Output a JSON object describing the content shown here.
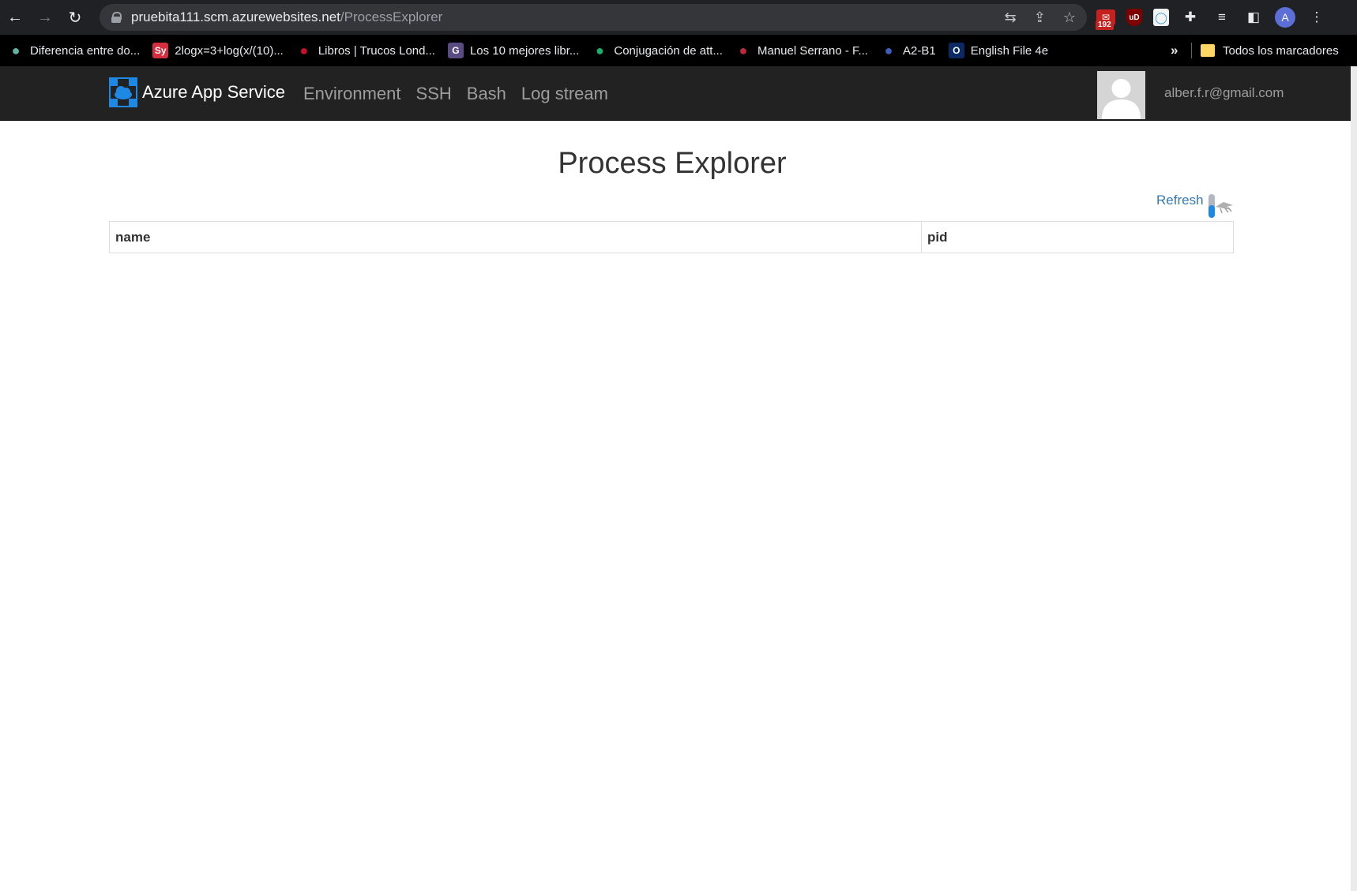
{
  "browser": {
    "url_host": "pruebita111.scm.azurewebsites.net",
    "url_path": "/ProcessExplorer",
    "mail_badge": "192",
    "ublock_label": "uD",
    "profile_initial": "A"
  },
  "bookmarks": {
    "items": [
      {
        "label": "Diferencia entre do...",
        "icon": "leaf-icon",
        "icon_text": "",
        "color": "#5fb3a1"
      },
      {
        "label": "2logx=3+log(x/(10)...",
        "icon": "symbolab-icon",
        "icon_text": "Sy",
        "color": "#d62d3f"
      },
      {
        "label": "Libros | Trucos Lond...",
        "icon": "union-jack-icon",
        "icon_text": "",
        "color": "#c8102e"
      },
      {
        "label": "Los 10 mejores libr...",
        "icon": "g-icon",
        "icon_text": "G",
        "color": "#5a4b82"
      },
      {
        "label": "Conjugación de att...",
        "icon": "green-bubble-icon",
        "icon_text": "",
        "color": "#17b26a"
      },
      {
        "label": "Manuel Serrano - F...",
        "icon": "signature-icon",
        "icon_text": "",
        "color": "#c0283b"
      },
      {
        "label": "A2-B1",
        "icon": "flag-icon",
        "icon_text": "",
        "color": "#3a5fbf"
      },
      {
        "label": "English File 4e",
        "icon": "oxford-icon",
        "icon_text": "O",
        "color": "#0a2a66"
      }
    ],
    "overflow": "»",
    "all_bookmarks": "Todos los marcadores"
  },
  "navbar": {
    "brand": "Azure App Service",
    "links": [
      "Environment",
      "SSH",
      "Bash",
      "Log stream"
    ],
    "user_email": "alber.f.r@gmail.com"
  },
  "page": {
    "title": "Process Explorer",
    "refresh_label": "Refresh"
  },
  "table": {
    "columns": [
      "name",
      "pid"
    ],
    "rows": []
  },
  "colors": {
    "navbar_bg": "#222222",
    "link_blue": "#337ab7",
    "azure_blue": "#1e88e5"
  }
}
